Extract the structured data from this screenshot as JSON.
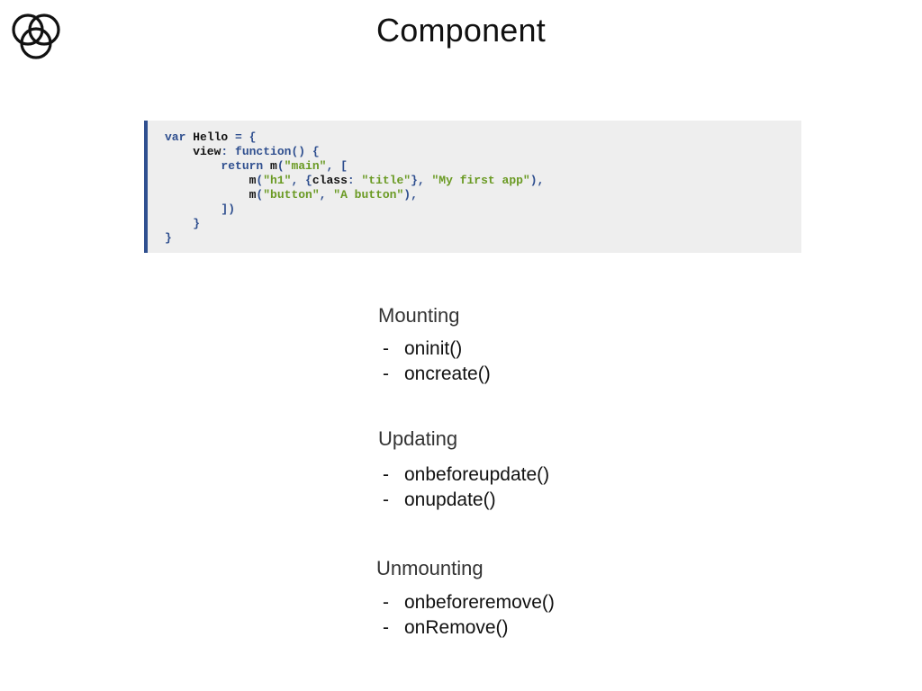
{
  "title": "Component",
  "code": {
    "lines": [
      [
        [
          "kw",
          "var "
        ],
        [
          "id",
          "Hello "
        ],
        [
          "pn",
          "= {"
        ]
      ],
      [
        [
          "id",
          "    view"
        ],
        [
          "pn",
          ": "
        ],
        [
          "kw",
          "function"
        ],
        [
          "pn",
          "() {"
        ]
      ],
      [
        [
          "kw",
          "        return "
        ],
        [
          "id",
          "m"
        ],
        [
          "pn",
          "("
        ],
        [
          "str",
          "\"main\""
        ],
        [
          "pn",
          ", ["
        ]
      ],
      [
        [
          "id",
          "            m"
        ],
        [
          "pn",
          "("
        ],
        [
          "str",
          "\"h1\""
        ],
        [
          "pn",
          ", {"
        ],
        [
          "id",
          "class"
        ],
        [
          "pn",
          ": "
        ],
        [
          "str",
          "\"title\""
        ],
        [
          "pn",
          "}, "
        ],
        [
          "str",
          "\"My first app\""
        ],
        [
          "pn",
          "),"
        ]
      ],
      [
        [
          "id",
          "            m"
        ],
        [
          "pn",
          "("
        ],
        [
          "str",
          "\"button\""
        ],
        [
          "pn",
          ", "
        ],
        [
          "str",
          "\"A button\""
        ],
        [
          "pn",
          "),"
        ]
      ],
      [
        [
          "pn",
          "        ])"
        ]
      ],
      [
        [
          "pn",
          "    }"
        ]
      ],
      [
        [
          "pn",
          "}"
        ]
      ]
    ]
  },
  "sections": {
    "mounting": {
      "heading": "Mounting",
      "items": [
        "oninit()",
        "oncreate()"
      ]
    },
    "updating": {
      "heading": "Updating",
      "items": [
        "onbeforeupdate()",
        "onupdate()"
      ]
    },
    "unmounting": {
      "heading": "Unmounting",
      "items": [
        "onbeforeremove()",
        "onRemove()"
      ]
    }
  },
  "bullet_glyph": "-",
  "colors": {
    "code_background": "#eeeeee",
    "code_border": "#2f4f8f",
    "keyword": "#2f4f8f",
    "string": "#6a9a23"
  },
  "icons": {
    "logo": "three-interlocking-circles-logo"
  }
}
